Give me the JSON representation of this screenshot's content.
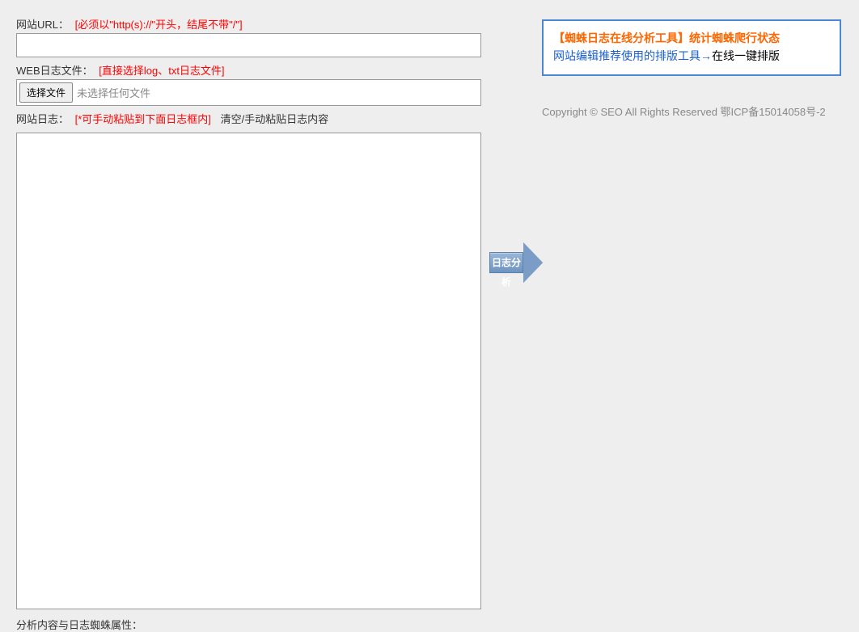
{
  "form": {
    "url_label": "网站URL：",
    "url_hint": "[必须以\"http(s)://\"开头，结尾不带\"/\"]",
    "url_value": "",
    "file_label": "WEB日志文件：",
    "file_hint": "[直接选择log、txt日志文件]",
    "file_button": "选择文件",
    "file_status": "未选择任何文件",
    "log_label": "网站日志：",
    "log_hint": "[*可手动粘贴到下面日志框内]",
    "clear_label": "清空/手动粘贴日志内容",
    "log_value": "",
    "bottom_label": "分析内容与日志蜘蛛属性："
  },
  "action": {
    "analyze": "日志分析"
  },
  "info": {
    "line1": "【蜘蛛日志在线分析工具】统计蜘蛛爬行状态",
    "line2a": "网站编辑推荐使用的排版工具",
    "arrow": "→",
    "line2b": "在线一键排版"
  },
  "copyright": "Copyright © SEO All Rights Reserved 鄂ICP备15014058号-2"
}
